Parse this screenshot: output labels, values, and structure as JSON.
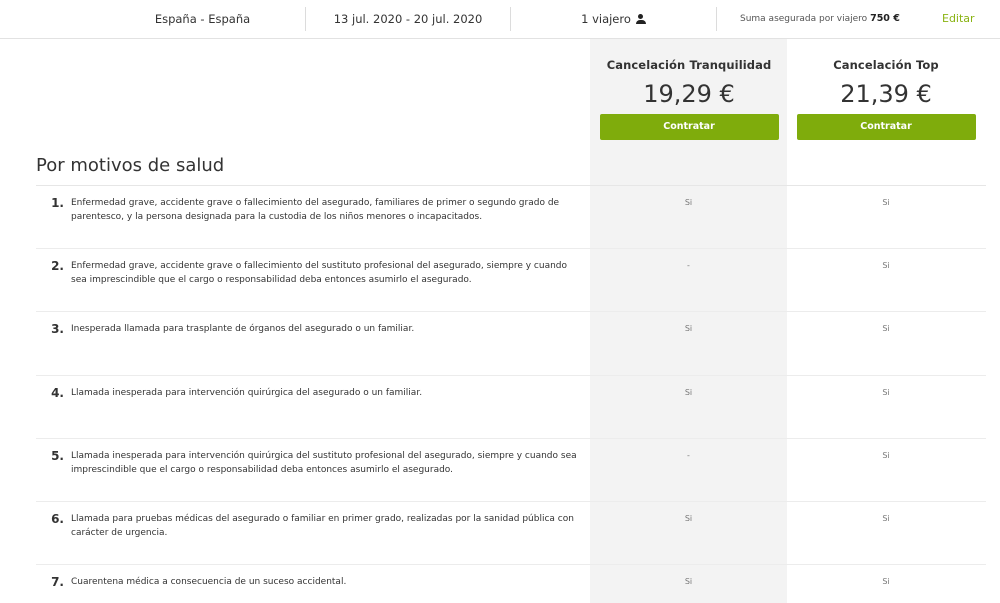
{
  "topbar": {
    "destination": "España - España",
    "dates": "13 jul. 2020 - 20 jul. 2020",
    "travelers": "1 viajero",
    "sum_label": "Suma asegurada por viajero",
    "sum_value": "750 €",
    "edit_label": "Editar",
    "accent_color": "#8ab313"
  },
  "plans": [
    {
      "name": "Cancelación Tranquilidad",
      "price": "19,29 €",
      "button": "Contratar"
    },
    {
      "name": "Cancelación Top",
      "price": "21,39 €",
      "button": "Contratar"
    }
  ],
  "section": {
    "title": "Por motivos de salud"
  },
  "rows": [
    {
      "num": "1.",
      "text": "Enfermedad grave, accidente grave o fallecimiento del asegurado, familiares de primer o segundo grado de parentesco, y la persona designada para la custodia de los niños menores o incapacitados.",
      "v1": "Si",
      "v2": "Si"
    },
    {
      "num": "2.",
      "text": "Enfermedad grave, accidente grave o fallecimiento del sustituto profesional del asegurado, siempre y cuando sea imprescindible que el cargo o responsabilidad deba entonces asumirlo el asegurado.",
      "v1": "-",
      "v2": "Si"
    },
    {
      "num": "3.",
      "text": "Inesperada llamada para trasplante de órganos del asegurado o un familiar.",
      "v1": "Si",
      "v2": "Si"
    },
    {
      "num": "4.",
      "text": "Llamada inesperada para intervención quirúrgica del asegurado o un familiar.",
      "v1": "Si",
      "v2": "Si"
    },
    {
      "num": "5.",
      "text": "Llamada inesperada para intervención quirúrgica del sustituto profesional del asegurado, siempre y cuando sea imprescindible que el cargo o responsabilidad deba entonces asumirlo el asegurado.",
      "v1": "-",
      "v2": "Si"
    },
    {
      "num": "6.",
      "text": "Llamada para pruebas médicas del asegurado o familiar en primer grado, realizadas por la sanidad pública con carácter de urgencia.",
      "v1": "Si",
      "v2": "Si"
    },
    {
      "num": "7.",
      "text": "Cuarentena médica a consecuencia de un suceso accidental.",
      "v1": "Si",
      "v2": "Si"
    }
  ]
}
